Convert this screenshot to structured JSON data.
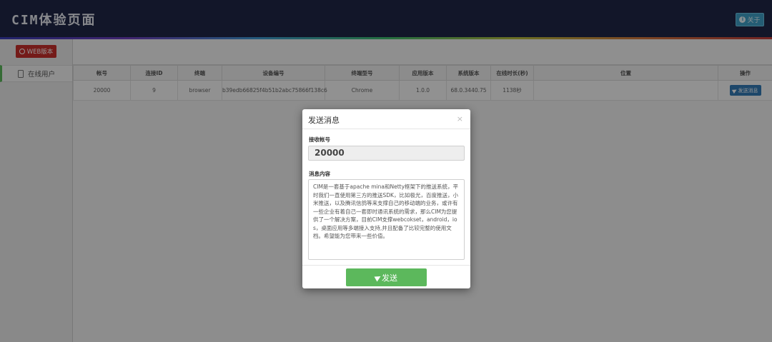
{
  "header": {
    "title": "CIM体验页面",
    "about_label": "关于"
  },
  "sidebar": {
    "web_button_label": "WEB版本",
    "items": [
      {
        "label": "在线用户"
      }
    ]
  },
  "table": {
    "columns": [
      "帐号",
      "连接ID",
      "终端",
      "设备编号",
      "终端型号",
      "应用版本",
      "系统版本",
      "在线时长(秒)",
      "位置",
      "操作"
    ],
    "rows": [
      {
        "account": "20000",
        "connection_id": "9",
        "terminal": "browser",
        "device_id": "b39edb66825f4b51b2abc75866f138c6",
        "model": "Chrome",
        "app_version": "1.0.0",
        "os_version": "68.0.3440.75",
        "online_duration": "1138秒",
        "location": "",
        "action_label": "发送消息"
      }
    ]
  },
  "modal": {
    "title": "发送消息",
    "close_symbol": "×",
    "receiver_label": "接收帐号",
    "receiver_value": "20000",
    "content_label": "消息内容",
    "content_value": "CIM是一套基于apache mina和Netty框架下的推送系统，平时我们一直使用第三方的推送SDK，比如极光，百度推送，小米推送，以及腾讯信鸽等来支撑自己的移动端的业务，或许有一些企业有着自己一套即时通讯系统的需求，那么CIM为您提供了一个解决方案，目前CIM支撑webcokset，android，ios，桌面应用等多端接入支持,并且配备了比较完整的使用文档。希望能为您带来一些价值。",
    "send_label": "发送"
  },
  "colors": {
    "header_bg": "#1f2748",
    "web_button": "#c9302c",
    "send_button": "#5cb85c",
    "action_button": "#337ab7",
    "about_button": "#3fa1c9"
  }
}
